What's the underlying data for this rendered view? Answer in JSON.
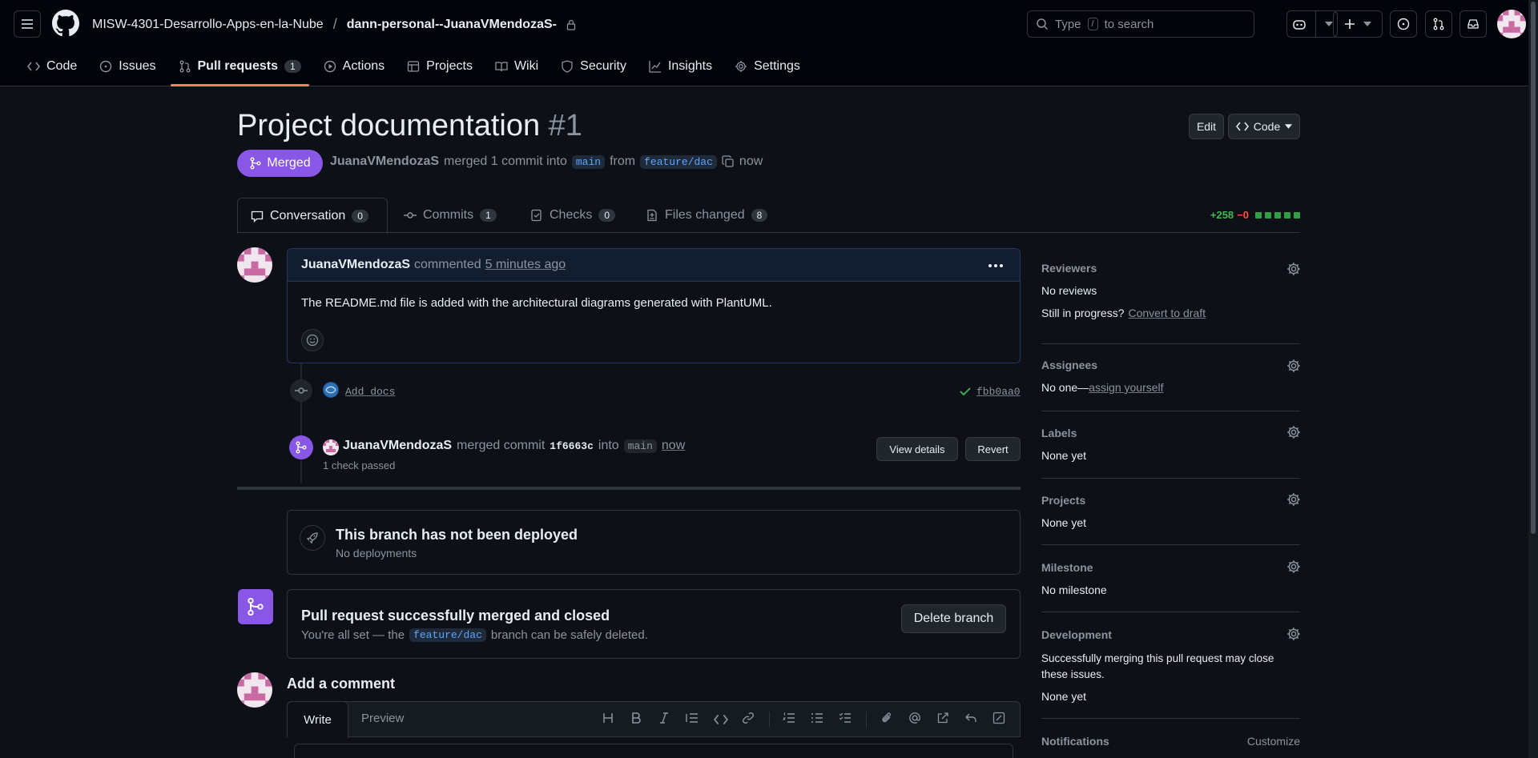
{
  "header": {
    "org": "MISW-4301-Desarrollo-Apps-en-la-Nube",
    "separator": "/",
    "repo": "dann-personal--JuanaVMendozaS-",
    "search_placeholder_before": "Type",
    "search_key": "/",
    "search_placeholder_after": "to search"
  },
  "repo_tabs": [
    {
      "label": "Code",
      "icon": "code-icon"
    },
    {
      "label": "Issues",
      "icon": "issue-icon"
    },
    {
      "label": "Pull requests",
      "icon": "pull-request-icon",
      "count": "1",
      "active": true
    },
    {
      "label": "Actions",
      "icon": "play-icon"
    },
    {
      "label": "Projects",
      "icon": "table-icon"
    },
    {
      "label": "Wiki",
      "icon": "book-icon"
    },
    {
      "label": "Security",
      "icon": "shield-icon"
    },
    {
      "label": "Insights",
      "icon": "graph-icon"
    },
    {
      "label": "Settings",
      "icon": "gear-icon"
    }
  ],
  "pr": {
    "title": "Project documentation",
    "number": "#1",
    "edit_label": "Edit",
    "code_label": "Code",
    "state": "Merged",
    "author": "JuanaVMendozaS",
    "merged_text": "merged 1 commit into",
    "base": "main",
    "from_text": "from",
    "head": "feature/dac",
    "time": "now"
  },
  "pr_tabs": [
    {
      "label": "Conversation",
      "count": "0",
      "icon": "comment-icon",
      "active": true
    },
    {
      "label": "Commits",
      "count": "1",
      "icon": "commit-icon"
    },
    {
      "label": "Checks",
      "count": "0",
      "icon": "checklist-icon"
    },
    {
      "label": "Files changed",
      "count": "8",
      "icon": "file-diff-icon"
    }
  ],
  "diffstat": {
    "additions": "+258",
    "deletions": "−0"
  },
  "comment": {
    "author": "JuanaVMendozaS",
    "action": "commented",
    "time": "5 minutes ago",
    "body": "The README.md file is added with the architectural diagrams generated with PlantUML."
  },
  "commit_event": {
    "message": "Add docs",
    "sha": "fbb0aa0"
  },
  "merge_event": {
    "author": "JuanaVMendozaS",
    "text": "merged commit",
    "sha": "1f6663c",
    "into_text": "into",
    "base": "main",
    "time": "now",
    "checks": "1 check passed",
    "view_details": "View details",
    "revert": "Revert"
  },
  "deploy": {
    "title": "This branch has not been deployed",
    "subtitle": "No deployments"
  },
  "merged_box": {
    "title": "Pull request successfully merged and closed",
    "text_before": "You're all set — the",
    "branch": "feature/dac",
    "text_after": "branch can be safely deleted.",
    "delete_label": "Delete branch"
  },
  "add_comment": {
    "title": "Add a comment",
    "tab_write": "Write",
    "tab_preview": "Preview"
  },
  "sidebar": {
    "reviewers": {
      "title": "Reviewers",
      "value": "No reviews",
      "progress": "Still in progress?",
      "draft_link": "Convert to draft"
    },
    "assignees": {
      "title": "Assignees",
      "value": "No one—",
      "link": "assign yourself"
    },
    "labels": {
      "title": "Labels",
      "value": "None yet"
    },
    "projects": {
      "title": "Projects",
      "value": "None yet"
    },
    "milestone": {
      "title": "Milestone",
      "value": "No milestone"
    },
    "development": {
      "title": "Development",
      "text": "Successfully merging this pull request may close these issues.",
      "value": "None yet"
    },
    "notifications": {
      "title": "Notifications",
      "customize": "Customize"
    }
  },
  "colors": {
    "accent": "#f78166",
    "merged": "#8957e5",
    "link": "#58a6ff",
    "success": "#3fb950",
    "danger": "#f85149"
  }
}
